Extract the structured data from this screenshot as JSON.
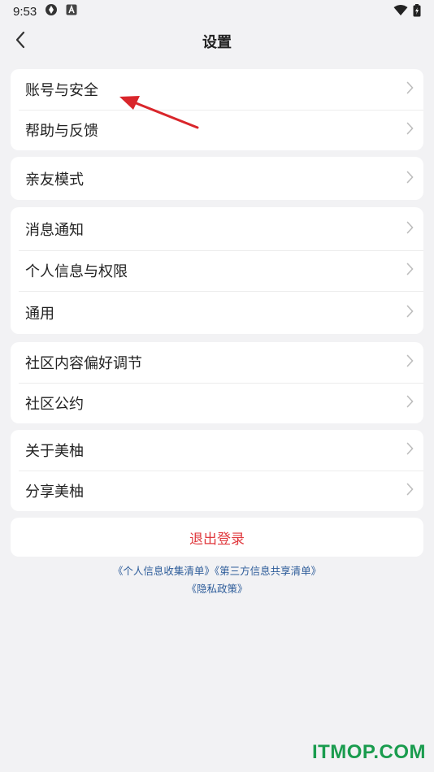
{
  "status_bar": {
    "time": "9:53"
  },
  "header": {
    "title": "设置",
    "back_icon": "chevron-left-icon"
  },
  "groups": [
    {
      "items": [
        {
          "label": "账号与安全"
        },
        {
          "label": "帮助与反馈"
        }
      ]
    },
    {
      "items": [
        {
          "label": "亲友模式"
        }
      ]
    },
    {
      "items": [
        {
          "label": "消息通知"
        },
        {
          "label": "个人信息与权限"
        },
        {
          "label": "通用"
        }
      ]
    },
    {
      "items": [
        {
          "label": "社区内容偏好调节"
        },
        {
          "label": "社区公约"
        }
      ]
    },
    {
      "items": [
        {
          "label": "关于美柚"
        },
        {
          "label": "分享美柚"
        }
      ]
    }
  ],
  "logout": {
    "label": "退出登录",
    "color": "#e0393e"
  },
  "links": {
    "personal_info_list": "《个人信息收集清单》",
    "third_party_list": "《第三方信息共享清单》",
    "privacy_policy": "《隐私政策》",
    "color": "#2e5d9a"
  },
  "annotation": {
    "arrow_color": "#d9262b"
  },
  "watermark": {
    "text": "ITMOP.COM",
    "color": "#1a9c4e"
  }
}
